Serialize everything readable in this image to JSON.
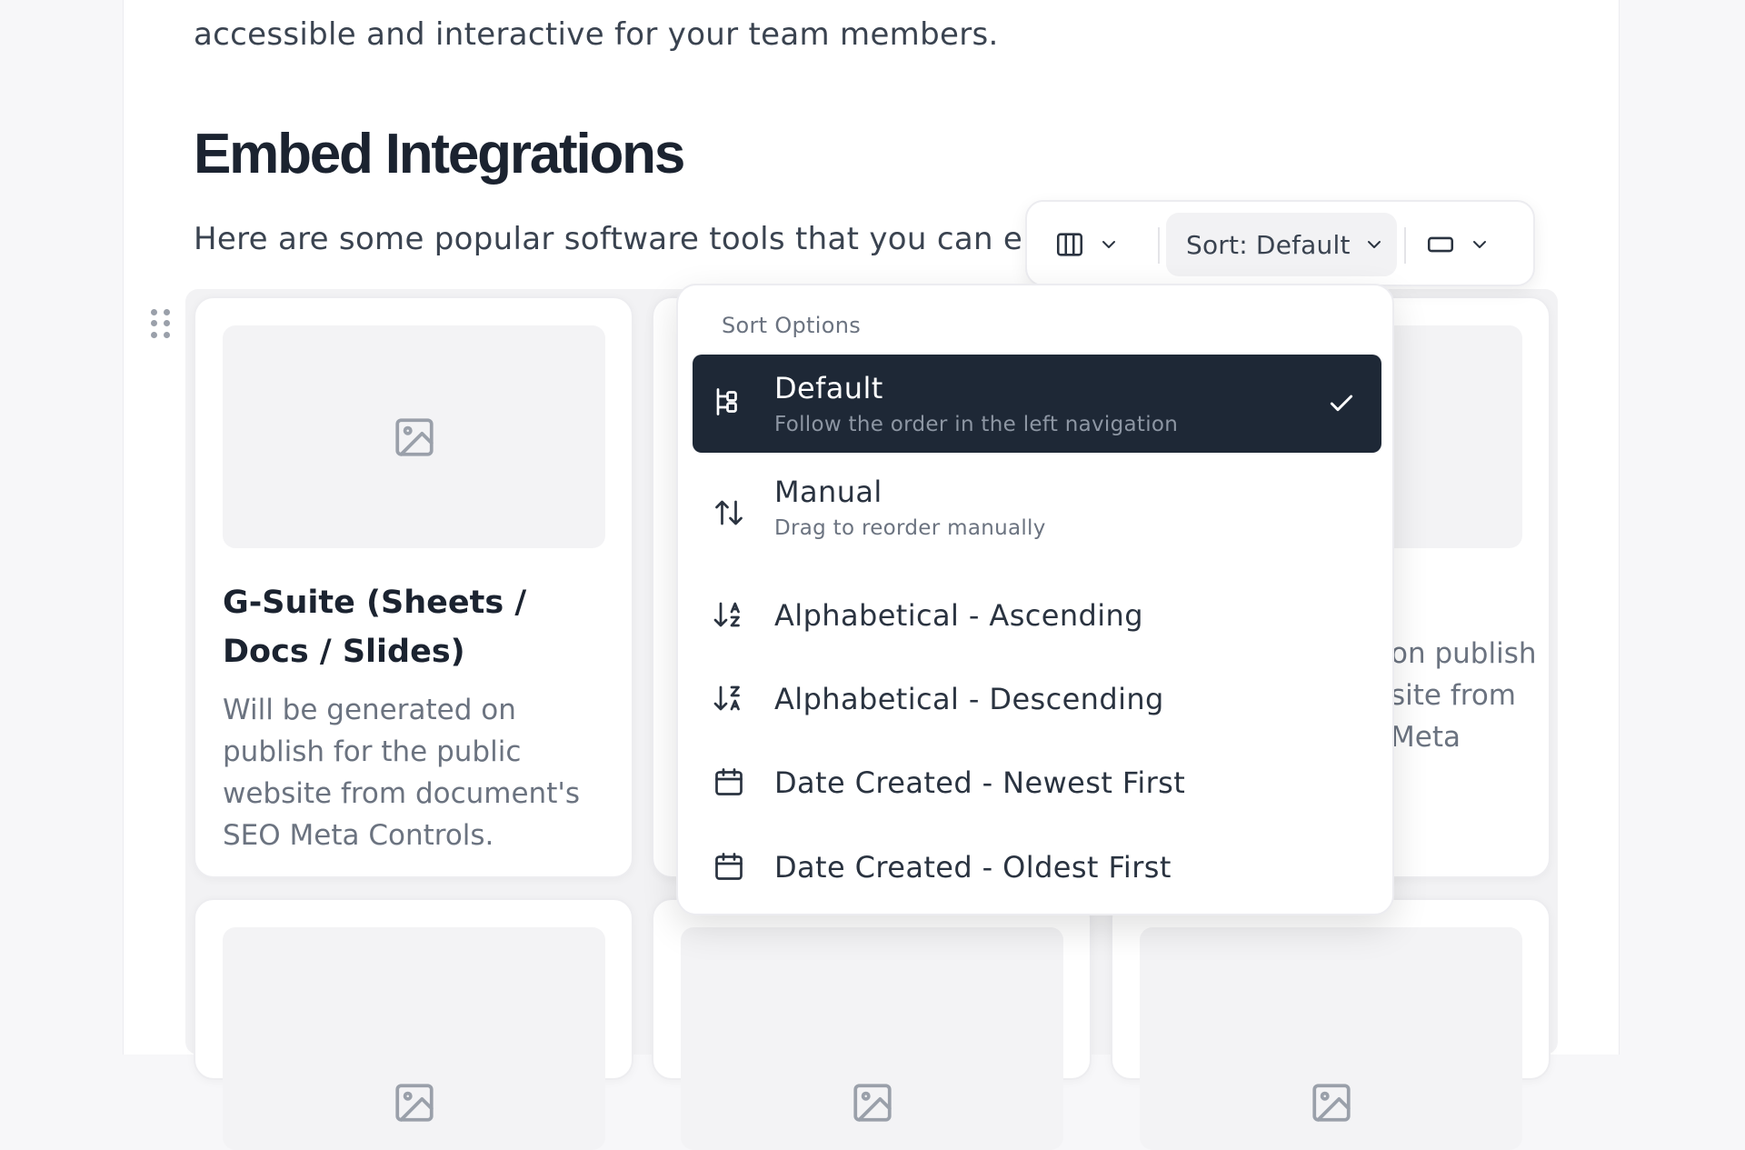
{
  "page": {
    "intro_tail": "accessible and interactive for your team members.",
    "section_title": "Embed Integrations",
    "section_desc": "Here are some popular software tools that you can embed"
  },
  "toolbar": {
    "columns_icon": "columns-icon",
    "sort_label": "Sort: Default",
    "width_icon": "card-width-icon"
  },
  "sort_menu": {
    "header": "Sort Options",
    "selected": "Default",
    "items": [
      {
        "label": "Default",
        "sublabel": "Follow the order in the left navigation",
        "icon": "tree-order-icon",
        "selected": true
      },
      {
        "label": "Manual",
        "sublabel": "Drag to reorder manually",
        "icon": "arrows-up-down-icon",
        "selected": false
      },
      {
        "label": "Alphabetical - Ascending",
        "icon": "sort-az-icon",
        "selected": false
      },
      {
        "label": "Alphabetical - Descending",
        "icon": "sort-za-icon",
        "selected": false
      },
      {
        "label": "Date Created - Newest First",
        "icon": "calendar-icon",
        "selected": false
      },
      {
        "label": "Date Created - Oldest First",
        "icon": "calendar-icon",
        "selected": false
      }
    ]
  },
  "cards": [
    {
      "title": "G-Suite (Sheets / Docs / Slides)",
      "description": "Will be generated on publish for the public website from document's SEO Meta Controls."
    },
    {
      "description_visible": "on publish\nsite from\nMeta"
    }
  ],
  "colors": {
    "accent_dark": "#1e2836",
    "text_primary": "#1b2330",
    "text_muted": "#6b7380"
  }
}
